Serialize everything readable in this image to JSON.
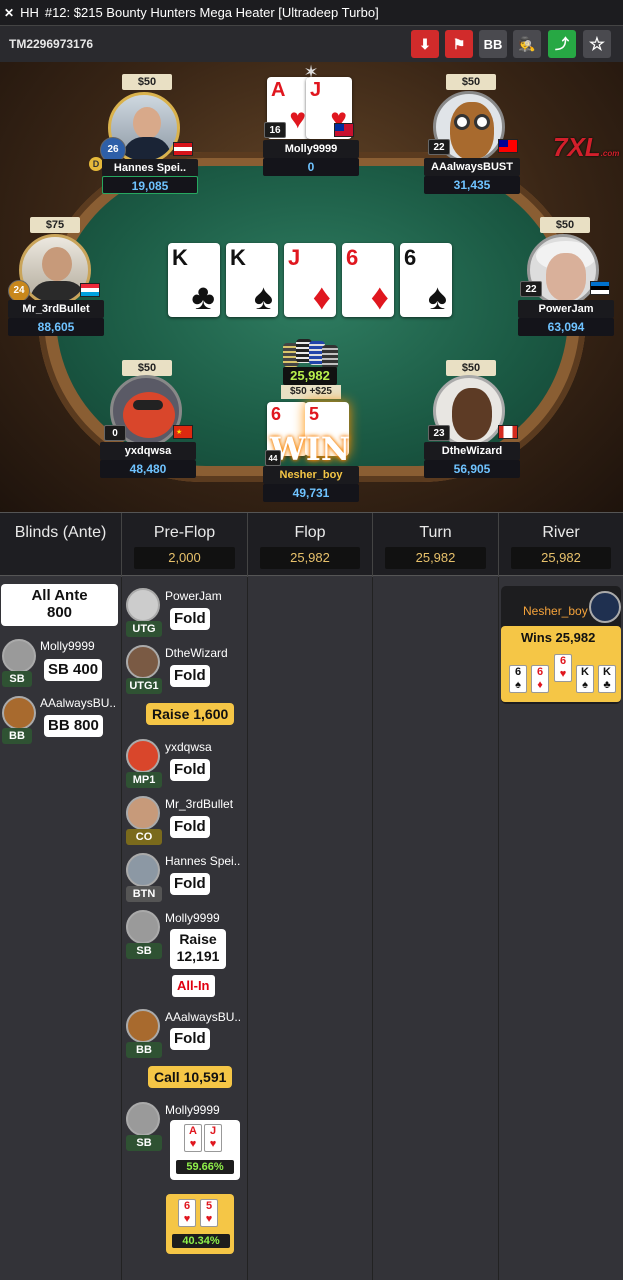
{
  "titlebar": {
    "logo": "✕",
    "prefix": "HH",
    "title": "#12: $215 Bounty Hunters Mega Heater [Ultradeep Turbo]"
  },
  "hand_id": "TM2296973176",
  "toolbar": {
    "download": "⬇",
    "flag": "⚑",
    "bb": "BB",
    "spy": "🕵",
    "share": "⤴",
    "star": "☆",
    "colors": {
      "download": "#d12b2b",
      "flag": "#d12b2b",
      "bb": "#4a4a4f",
      "spy": "#4a4a4f",
      "share": "#27a844",
      "star": "#4a4a4f"
    }
  },
  "brand": {
    "logo_main": "7XL",
    "logo_sub": ".com"
  },
  "seats": [
    {
      "bounty": "$50",
      "name": "Hannes Spei..",
      "stack": "19,085",
      "level": "26",
      "dealer": "D"
    },
    {
      "bounty": "",
      "name": "Molly9999",
      "stack": "0",
      "level": "16",
      "hole": [
        {
          "rank": "A",
          "suit": "♥"
        },
        {
          "rank": "J",
          "suit": "♥"
        }
      ]
    },
    {
      "bounty": "$50",
      "name": "AAalwaysBUST",
      "stack": "31,435",
      "level": "22"
    },
    {
      "bounty": "$75",
      "name": "Mr_3rdBullet",
      "stack": "88,605",
      "level": "24"
    },
    {
      "bounty": "$50",
      "name": "PowerJam",
      "stack": "63,094",
      "level": "22"
    },
    {
      "bounty": "$50",
      "name": "yxdqwsa",
      "stack": "48,480",
      "level": "0"
    },
    {
      "bounty": "$50 +$25",
      "name": "Nesher_boy",
      "stack": "49,731",
      "level": "44",
      "hole": [
        {
          "rank": "6",
          "suit": "♥"
        },
        {
          "rank": "5",
          "suit": "♥"
        }
      ],
      "win": "WIN"
    },
    {
      "bounty": "$50",
      "name": "DtheWizard",
      "stack": "56,905",
      "level": "23"
    }
  ],
  "board": [
    {
      "rank": "K",
      "suit": "♣"
    },
    {
      "rank": "K",
      "suit": "♠"
    },
    {
      "rank": "J",
      "suit": "♦"
    },
    {
      "rank": "6",
      "suit": "♦"
    },
    {
      "rank": "6",
      "suit": "♠"
    }
  ],
  "pot": "25,982",
  "streets": [
    {
      "label": "Blinds (Ante)",
      "amount": ""
    },
    {
      "label": "Pre-Flop",
      "amount": "2,000"
    },
    {
      "label": "Flop",
      "amount": "25,982"
    },
    {
      "label": "Turn",
      "amount": "25,982"
    },
    {
      "label": "River",
      "amount": "25,982"
    }
  ],
  "blinds": {
    "ante_label": "All Ante",
    "ante_amount": "800",
    "actions": [
      {
        "name": "Molly9999",
        "pos": "SB",
        "action": "SB 400"
      },
      {
        "name": "AAalwaysBU..",
        "pos": "BB",
        "action": "BB 800"
      }
    ]
  },
  "preflop": [
    {
      "name": "PowerJam",
      "pos": "UTG",
      "action": "Fold"
    },
    {
      "name": "DtheWizard",
      "pos": "UTG1",
      "action": "Fold"
    },
    {
      "hero_action": "Raise 1,600"
    },
    {
      "name": "yxdqwsa",
      "pos": "MP1",
      "action": "Fold"
    },
    {
      "name": "Mr_3rdBullet",
      "pos": "CO",
      "action": "Fold"
    },
    {
      "name": "Hannes Spei..",
      "pos": "BTN",
      "action": "Fold"
    },
    {
      "name": "Molly9999",
      "pos": "SB",
      "action": "Raise",
      "action2": "12,191",
      "allin": "All-In"
    },
    {
      "name": "AAalwaysBU..",
      "pos": "BB",
      "action": "Fold"
    },
    {
      "hero_action": "Call 10,591"
    },
    {
      "name": "Molly9999",
      "pos": "SB",
      "cards": [
        {
          "rank": "A",
          "suit": "♥"
        },
        {
          "rank": "J",
          "suit": "♥"
        }
      ],
      "equity": "59.66%"
    },
    {
      "cards": [
        {
          "rank": "6",
          "suit": "♥"
        },
        {
          "rank": "5",
          "suit": "♥"
        }
      ],
      "equity": "40.34%"
    }
  ],
  "river": {
    "name": "Nesher_boy",
    "wins": "Wins 25,982",
    "cards": [
      {
        "rank": "6",
        "suit": "♠"
      },
      {
        "rank": "6",
        "suit": "♦"
      },
      {
        "rank": "6",
        "suit": "♥"
      },
      {
        "rank": "K",
        "suit": "♠"
      },
      {
        "rank": "K",
        "suit": "♣"
      }
    ]
  }
}
